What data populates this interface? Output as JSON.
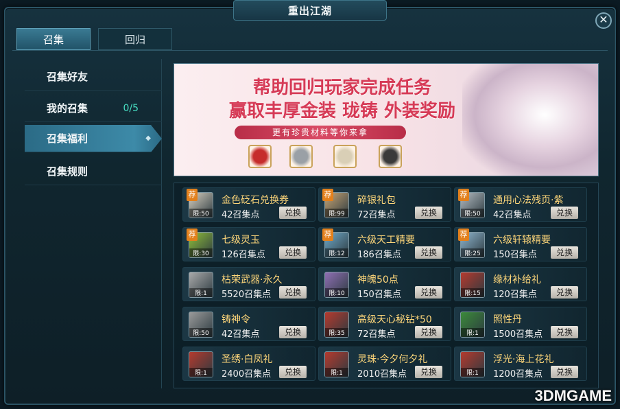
{
  "window": {
    "title": "重出江湖"
  },
  "tabs": [
    {
      "label": "召集",
      "active": true
    },
    {
      "label": "回归",
      "active": false
    }
  ],
  "sidebar": {
    "items": [
      {
        "label": "召集好友",
        "count": "",
        "active": false
      },
      {
        "label": "我的召集",
        "count": "0/5",
        "active": false
      },
      {
        "label": "召集福利",
        "count": "",
        "active": true
      },
      {
        "label": "召集规则",
        "count": "",
        "active": false
      }
    ]
  },
  "banner": {
    "line1": "帮助回归玩家完成任务",
    "line2": "赢取丰厚金装 珑铸 外装奖励",
    "ribbon": "更有珍贵材料等你来拿",
    "gem_colors": [
      "#c62c2c",
      "#9aa0a6",
      "#d9cfb6",
      "#3a3a3a"
    ]
  },
  "rewards": [
    {
      "name": "金色砭石兑换券",
      "cost": "42召集点",
      "limit": "限:50",
      "recommended": true,
      "button": "兑换",
      "color": "#d8d0c0"
    },
    {
      "name": "碎银礼包",
      "cost": "72召集点",
      "limit": "限:99",
      "recommended": true,
      "button": "兑换",
      "color": "#c9a574"
    },
    {
      "name": "通用心法残页·紫",
      "cost": "42召集点",
      "limit": "限:50",
      "recommended": true,
      "button": "兑换",
      "color": "#b5bcc2"
    },
    {
      "name": "七级灵玉",
      "cost": "126召集点",
      "limit": "限:30",
      "recommended": true,
      "button": "兑换",
      "color": "#8fbf3a"
    },
    {
      "name": "六级天工精要",
      "cost": "186召集点",
      "limit": "限:12",
      "recommended": true,
      "button": "兑换",
      "color": "#6fa9c9"
    },
    {
      "name": "六级轩辕精要",
      "cost": "150召集点",
      "limit": "限:25",
      "recommended": true,
      "button": "兑换",
      "color": "#8fb6cf"
    },
    {
      "name": "枯荣武器·永久",
      "cost": "5520召集点",
      "limit": "限:1",
      "recommended": false,
      "button": "兑换",
      "color": "#a9a9a9"
    },
    {
      "name": "神魄50点",
      "cost": "150召集点",
      "limit": "限:10",
      "recommended": false,
      "button": "兑换",
      "color": "#8f6fb3"
    },
    {
      "name": "缘材补给礼",
      "cost": "120召集点",
      "limit": "限:15",
      "recommended": false,
      "button": "兑换",
      "color": "#b53a2e"
    },
    {
      "name": "铸神令",
      "cost": "42召集点",
      "limit": "限:50",
      "recommended": false,
      "button": "兑换",
      "color": "#9a9a9a"
    },
    {
      "name": "高级天心秘钻*50",
      "cost": "72召集点",
      "limit": "限:35",
      "recommended": false,
      "button": "兑换",
      "color": "#b53a2e"
    },
    {
      "name": "照性丹",
      "cost": "1500召集点",
      "limit": "限:1",
      "recommended": false,
      "button": "兑换",
      "color": "#3c8a3a"
    },
    {
      "name": "圣绣·白凤礼",
      "cost": "2400召集点",
      "limit": "限:1",
      "recommended": false,
      "button": "兑换",
      "color": "#b53a2e"
    },
    {
      "name": "灵珠·今夕何夕礼",
      "cost": "2010召集点",
      "limit": "限:1",
      "recommended": false,
      "button": "兑换",
      "color": "#b53a2e"
    },
    {
      "name": "浮光·海上花礼",
      "cost": "1200召集点",
      "limit": "限:1",
      "recommended": false,
      "button": "兑换",
      "color": "#b53a2e"
    }
  ],
  "recommend_badge": "荐",
  "watermark": "3DMGAME"
}
